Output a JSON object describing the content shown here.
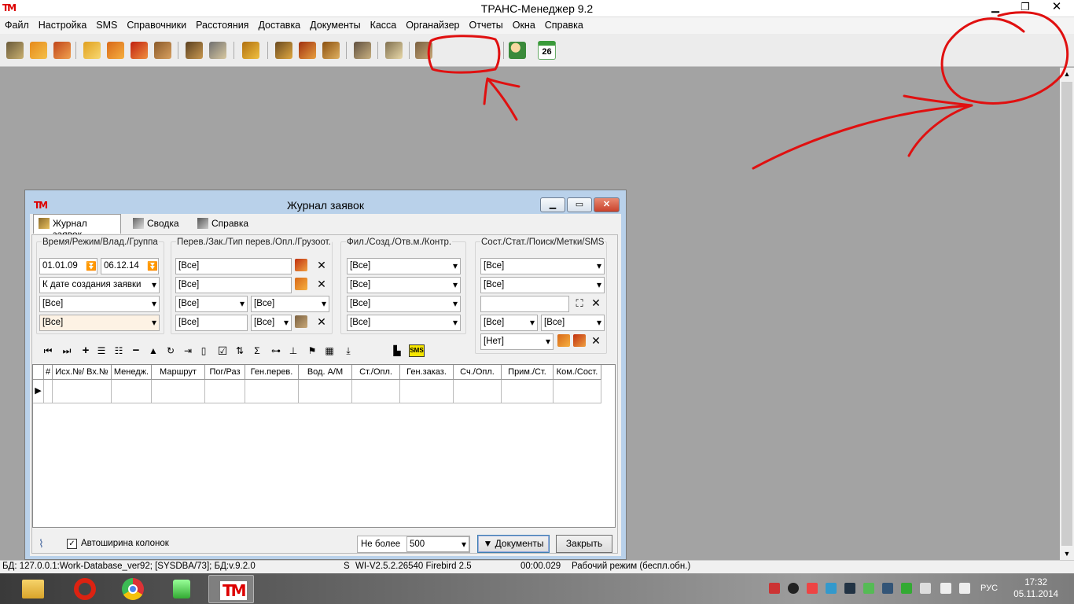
{
  "app": {
    "title": "ТРАНС-Менеджер 9.2",
    "logo_text": "ТМ"
  },
  "menu": [
    "Файл",
    "Настройка",
    "SMS",
    "Справочники",
    "Расстояния",
    "Доставка",
    "Документы",
    "Касса",
    "Органайзер",
    "Отчеты",
    "Окна",
    "Справка"
  ],
  "toolbar": {
    "calendar_day": "26",
    "icons": [
      "order-new-icon",
      "order-edit-icon",
      "order-copy-icon",
      "book-icon",
      "house-icon",
      "truck-icon",
      "box-open-icon",
      "cargo-icon",
      "tools-icon",
      "wallet-icon",
      "person-cargo-icon",
      "user-cargo-icon",
      "pencil-icon",
      "triangle-icon",
      "document-icon",
      "package-icon",
      "user-add-icon",
      "calendar-icon"
    ]
  },
  "journal": {
    "title": "Журнал заявок",
    "tabs": [
      {
        "label": "Журнал заявок",
        "icon": "journal-icon",
        "active": true
      },
      {
        "label": "Сводка",
        "icon": "summary-icon",
        "active": false
      },
      {
        "label": "Справка",
        "icon": "help-book-icon",
        "active": false
      }
    ],
    "groups": {
      "time": {
        "title": "Время/Режим/Влад./Группа",
        "date_from": "01.01.09",
        "date_to": "06.12.14",
        "mode": "К дате создания заявки",
        "owner": "[Все]",
        "group": "[Все]"
      },
      "carrier": {
        "title": "Перев./Зак./Тип перев./Опл./Грузоот.",
        "carrier": "[Все]",
        "customer": "[Все]",
        "type": "[Все]",
        "payment": "[Все]",
        "shipper": "[Все]",
        "extra": "[Все]"
      },
      "branch": {
        "title": "Фил./Созд./Отв.м./Контр.",
        "branch": "[Все]",
        "creator": "[Все]",
        "responsible": "[Все]",
        "control": "[Все]"
      },
      "state": {
        "title": "Сост./Стат./Поиск/Метки/SMS",
        "state": "[Все]",
        "status": "[Все]",
        "search": "",
        "mark1": "[Все]",
        "mark2": "[Все]",
        "sms": "[Нет]"
      }
    },
    "nav_icons": [
      "first-icon",
      "last-icon",
      "add-icon",
      "filter-icon",
      "list-icon",
      "remove-icon",
      "up-icon",
      "refresh-icon",
      "end-icon",
      "clip-icon",
      "check-icon",
      "sort-icon",
      "sum-icon",
      "tree-icon",
      "org-icon",
      "flag-icon",
      "grid-icon",
      "export-icon",
      "align-icon",
      "sms-icon"
    ],
    "sms_label": "SMS",
    "columns": [
      "#",
      "Исх.№/ Вх.№",
      "Менедж.",
      "Маршрут",
      "Пог/Раз",
      "Ген.перев.",
      "Вод. А/М",
      "Ст./Опл.",
      "Ген.заказ.",
      "Сч./Опл.",
      "Прим./Ст.",
      "Ком./Сост."
    ],
    "autowidth_label": "Автоширина колонок",
    "autowidth_checked": "✓",
    "limit_label": "Не более",
    "limit_value": "500",
    "documents_button": "▼ Документы",
    "close_button": "Закрыть"
  },
  "statusbar": {
    "db": "БД: 127.0.0.1:Work-Database_ver92; [SYSDBA/73]; БД:v.9.2.0",
    "s": "S",
    "server": "WI-V2.5.2.26540 Firebird 2.5",
    "time": "00:00.029",
    "mode": "Рабочий режим (беспл.обн.)"
  },
  "taskbar": {
    "apps": [
      "explorer-icon",
      "opera-icon",
      "chrome-icon",
      "app-icon",
      "trans-manager-icon"
    ],
    "lang": "РУС",
    "time": "17:32",
    "date": "05.11.2014"
  },
  "colors": {
    "mdi_background": "#a3a3a3",
    "window_frame": "#b9d1ea",
    "annotation": "#e01010",
    "logo": "#dd0000"
  }
}
